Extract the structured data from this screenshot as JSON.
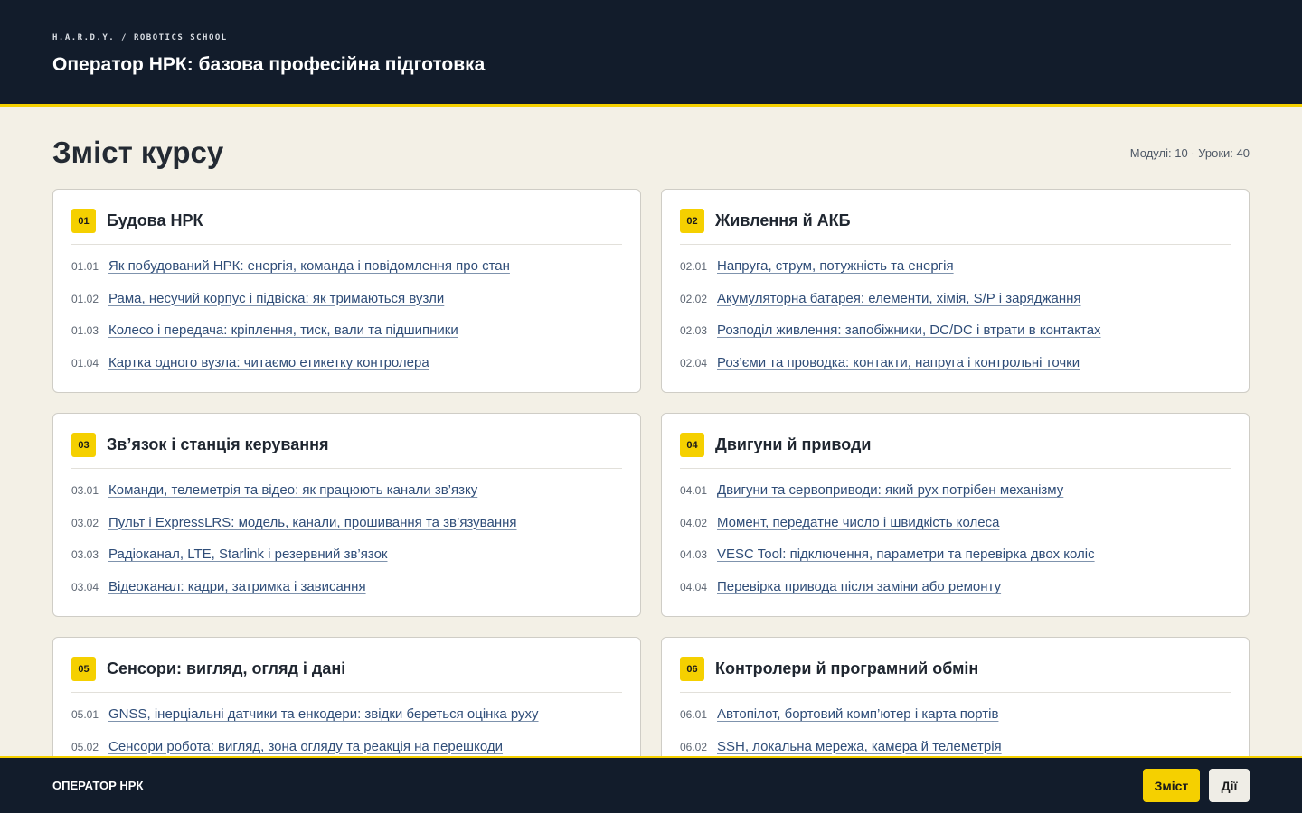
{
  "header": {
    "brand": "H.A.R.D.Y. / ROBOTICS SCHOOL",
    "title": "Оператор НРК: базова професійна підготовка"
  },
  "page": {
    "title": "Зміст курсу",
    "stats": "Модулі: 10 · Уроки: 40"
  },
  "modules": [
    {
      "num": "01",
      "title": "Будова НРК",
      "lessons": [
        {
          "num": "01.01",
          "title": "Як побудований НРК: енергія, команда і повідомлення про стан"
        },
        {
          "num": "01.02",
          "title": "Рама, несучий корпус і підвіска: як тримаються вузли"
        },
        {
          "num": "01.03",
          "title": "Колесо і передача: кріплення, тиск, вали та підшипники"
        },
        {
          "num": "01.04",
          "title": "Картка одного вузла: читаємо етикетку контролера"
        }
      ]
    },
    {
      "num": "02",
      "title": "Живлення й АКБ",
      "lessons": [
        {
          "num": "02.01",
          "title": "Напруга, струм, потужність та енергія"
        },
        {
          "num": "02.02",
          "title": "Акумуляторна батарея: елементи, хімія, S/P і заряджання"
        },
        {
          "num": "02.03",
          "title": "Розподіл живлення: запобіжники, DC/DC і втрати в контактах"
        },
        {
          "num": "02.04",
          "title": "Роз’єми та проводка: контакти, напруга і контрольні точки"
        }
      ]
    },
    {
      "num": "03",
      "title": "Зв’язок і станція керування",
      "lessons": [
        {
          "num": "03.01",
          "title": "Команди, телеметрія та відео: як працюють канали зв’язку"
        },
        {
          "num": "03.02",
          "title": "Пульт і ExpressLRS: модель, канали, прошивання та зв’язування"
        },
        {
          "num": "03.03",
          "title": "Радіоканал, LTE, Starlink і резервний зв’язок"
        },
        {
          "num": "03.04",
          "title": "Відеоканал: кадри, затримка і зависання"
        }
      ]
    },
    {
      "num": "04",
      "title": "Двигуни й приводи",
      "lessons": [
        {
          "num": "04.01",
          "title": "Двигуни та сервоприводи: який рух потрібен механізму"
        },
        {
          "num": "04.02",
          "title": "Момент, передатне число і швидкість колеса"
        },
        {
          "num": "04.03",
          "title": "VESC Tool: підключення, параметри та перевірка двох коліс"
        },
        {
          "num": "04.04",
          "title": "Перевірка привода після заміни або ремонту"
        }
      ]
    },
    {
      "num": "05",
      "title": "Сенсори: вигляд, огляд і дані",
      "lessons": [
        {
          "num": "05.01",
          "title": "GNSS, інерціальні датчики та енкодери: звідки береться оцінка руху"
        },
        {
          "num": "05.02",
          "title": "Сенсори робота: вигляд, зона огляду та реакція на перешкоди"
        }
      ]
    },
    {
      "num": "06",
      "title": "Контролери й програмний обмін",
      "lessons": [
        {
          "num": "06.01",
          "title": "Автопілот, бортовий комп’ютер і карта портів"
        },
        {
          "num": "06.02",
          "title": "SSH, локальна мережа, камера й телеметрія"
        }
      ]
    }
  ],
  "footer": {
    "title": "ОПЕРАТОР НРК",
    "contents_button": "Зміст",
    "actions_button": "Дії"
  },
  "colors": {
    "accent": "#f5d000",
    "header_bg": "#121c2b",
    "page_bg": "#f3f0e6",
    "link": "#2f4d78"
  }
}
